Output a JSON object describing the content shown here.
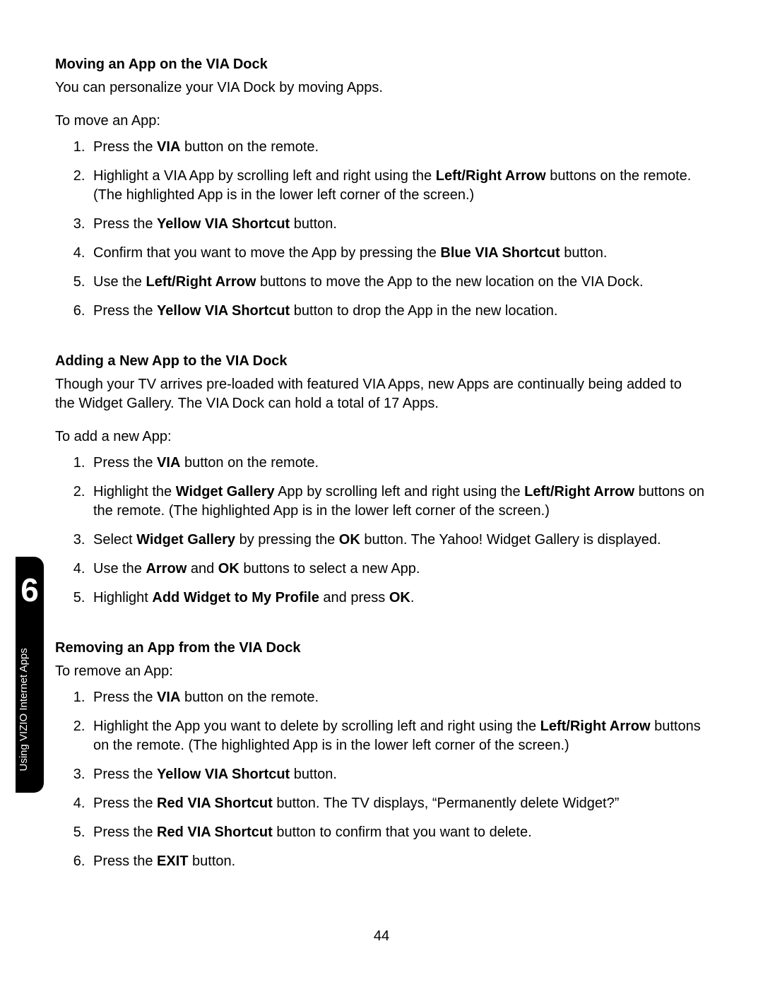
{
  "chapter": {
    "number": "6",
    "title": "Using VIZIO Internet Apps"
  },
  "page_number": "44",
  "sections": [
    {
      "heading": "Moving an App on the VIA Dock",
      "intro": "You can personalize your VIA Dock by moving Apps.",
      "lead": "To move an App:",
      "steps_html": [
        "Press the <b>VIA</b> button on the remote.",
        "Highlight a VIA App by scrolling left and right using the <b>Left/Right Arrow</b> buttons on the remote. (The highlighted App is in the lower left corner of the screen.)",
        "Press the <b>Yellow VIA Shortcut</b> button.",
        "Confirm that you want to move the App by pressing the <b>Blue VIA Shortcut</b> button.",
        "Use the <b>Left/Right Arrow</b> buttons to move the App to the new location on the VIA Dock.",
        "Press the <b>Yellow VIA Shortcut</b> button to drop the App in the new location."
      ]
    },
    {
      "heading": "Adding a New App to the VIA Dock",
      "intro": "Though your TV arrives pre-loaded with featured VIA Apps, new Apps are continually being added to the Widget Gallery. The VIA Dock can hold a total of 17 Apps.",
      "lead": "To add a new App:",
      "steps_html": [
        "Press the <b>VIA</b> button on the remote.",
        "Highlight the <b>Widget Gallery</b> App by scrolling left and right using the <b>Left/Right Arrow</b> buttons on the remote. (The highlighted App is in the lower left corner of the screen.)",
        "Select <b>Widget Gallery</b> by pressing the <b>OK</b> button. The Yahoo! Widget Gallery is displayed.",
        "Use the <b>Arrow</b> and <b>OK</b> buttons to select a new App.",
        "Highlight <b>Add Widget to My Profile</b> and press <b>OK</b>."
      ]
    },
    {
      "heading": "Removing an App from the VIA Dock",
      "intro": "",
      "lead": "To remove an App:",
      "steps_html": [
        "Press the <b>VIA</b> button on the remote.",
        "Highlight the App you want to delete by scrolling left and right using the <b>Left/Right Arrow</b> buttons on the remote. (The highlighted App is in the lower left corner of the screen.)",
        "Press the <b>Yellow VIA Shortcut</b> button.",
        "Press the <b>Red VIA Shortcut</b> button. The TV displays, “Permanently delete Widget?”",
        "Press the <b>Red VIA Shortcut</b> button to confirm that you want to delete.",
        "Press the <b>EXIT</b> button."
      ]
    }
  ]
}
